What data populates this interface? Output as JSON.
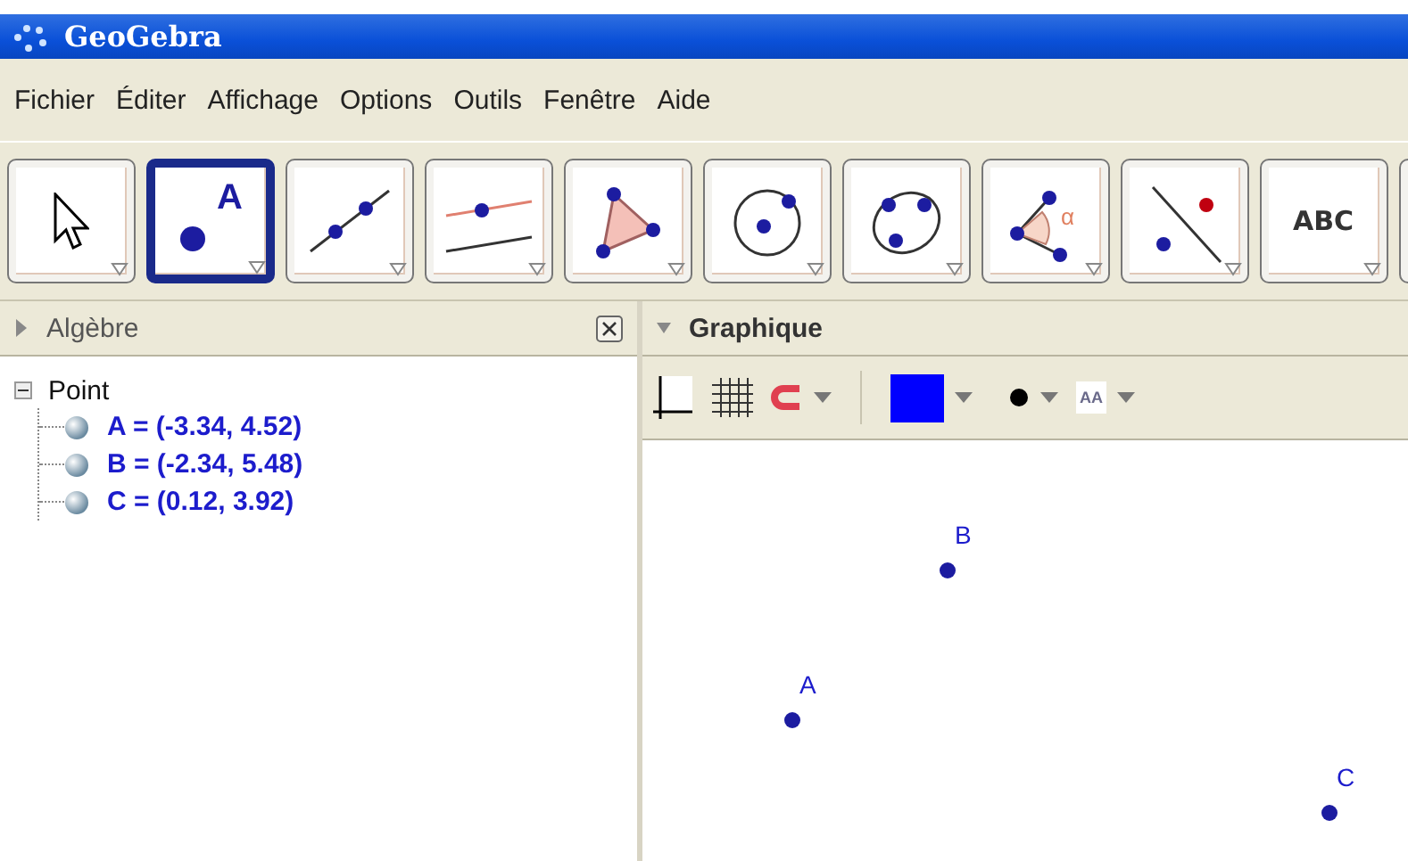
{
  "window": {
    "title": "GeoGebra"
  },
  "menu": [
    "Fichier",
    "Éditer",
    "Affichage",
    "Options",
    "Outils",
    "Fenêtre",
    "Aide"
  ],
  "tools": [
    {
      "kind": "move",
      "selected": false
    },
    {
      "kind": "point",
      "selected": true,
      "label": "A"
    },
    {
      "kind": "line",
      "selected": false
    },
    {
      "kind": "parallel",
      "selected": false
    },
    {
      "kind": "polygon",
      "selected": false
    },
    {
      "kind": "circle",
      "selected": false
    },
    {
      "kind": "conic",
      "selected": false
    },
    {
      "kind": "angle",
      "selected": false,
      "label": "α"
    },
    {
      "kind": "reflect",
      "selected": false
    },
    {
      "kind": "text",
      "selected": false,
      "label": "ABC"
    },
    {
      "kind": "unknown",
      "selected": false
    }
  ],
  "algebra": {
    "title": "Algèbre",
    "expanded": false,
    "groups": [
      {
        "label": "Point",
        "expanded": true,
        "children": [
          {
            "label": "A = (-3.34, 4.52)"
          },
          {
            "label": "B = (-2.34, 5.48)"
          },
          {
            "label": "C = (0.12, 3.92)"
          }
        ]
      }
    ]
  },
  "graphics": {
    "title": "Graphique",
    "expanded": true,
    "style_bar": {
      "color": "#0000ff",
      "text_style": "AA"
    },
    "points": [
      {
        "label": "A"
      },
      {
        "label": "B"
      },
      {
        "label": "C"
      }
    ]
  }
}
